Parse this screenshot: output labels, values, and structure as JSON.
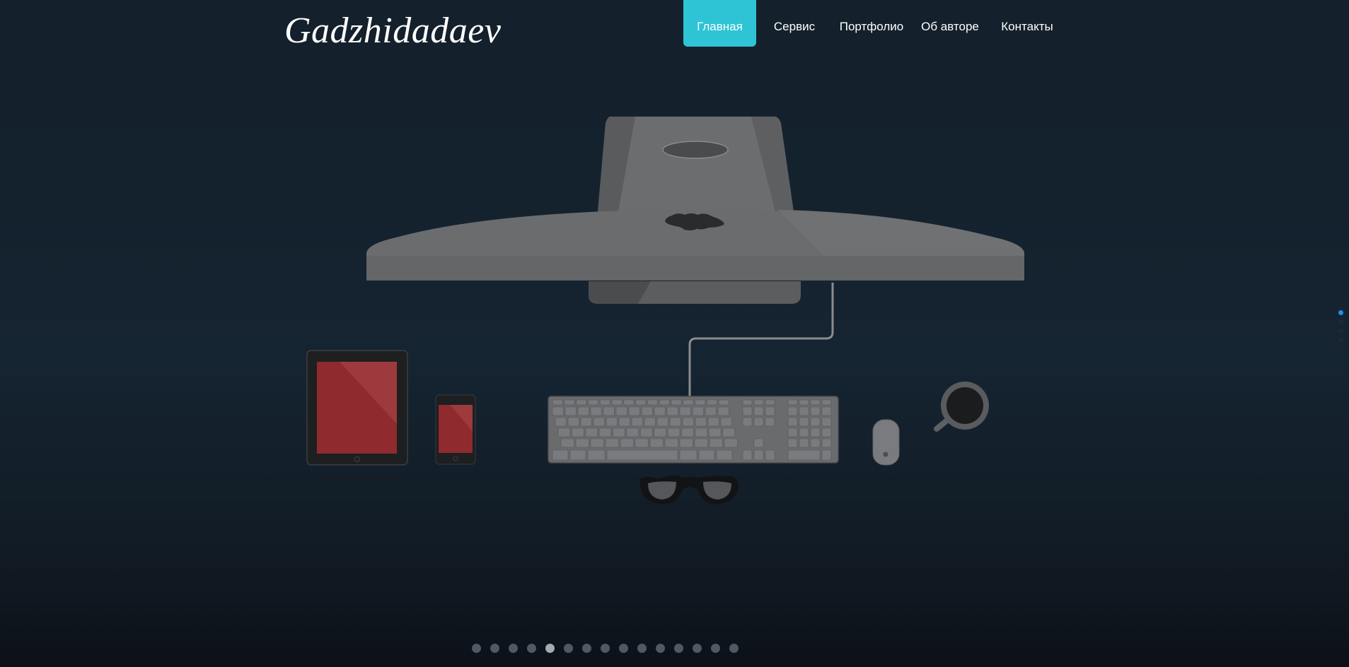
{
  "brand": {
    "logo_text": "Gadzhidadaev"
  },
  "nav": {
    "items": [
      {
        "label": "Главная",
        "active": true
      },
      {
        "label": "Сервис",
        "active": false
      },
      {
        "label": "Портфолио",
        "active": false
      },
      {
        "label": "Об авторе",
        "active": false
      },
      {
        "label": "Контакты",
        "active": false
      }
    ]
  },
  "hero": {
    "illustration": "desk-top-view",
    "objects": [
      "imac",
      "keyboard",
      "ipad",
      "iphone",
      "mouse",
      "coffee-cup",
      "glasses",
      "cable"
    ]
  },
  "side_pagination": {
    "count": 4,
    "active_index": 0
  },
  "slider_pagination": {
    "count": 15,
    "active_index": 4
  },
  "colors": {
    "accent": "#2ec4d6",
    "background": "#152431",
    "device_gray": "#6a6b6d",
    "screen_red": "#8f2a2e",
    "side_dot_active": "#1e8fe8"
  }
}
